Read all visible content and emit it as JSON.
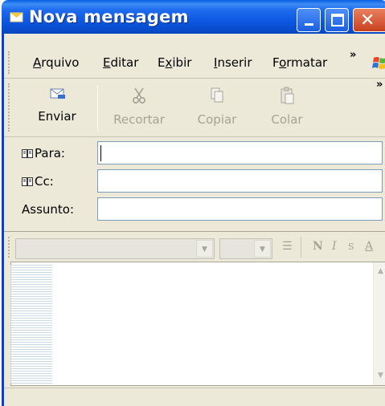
{
  "window": {
    "title": "Nova mensagem"
  },
  "menu": {
    "items": [
      {
        "label": "Arquivo",
        "accel": "A",
        "rest": "rquivo"
      },
      {
        "label": "Editar",
        "accel": "E",
        "rest": "ditar"
      },
      {
        "label": "Exibir",
        "pre": "E",
        "accel": "x",
        "rest": "ibir"
      },
      {
        "label": "Inserir",
        "accel": "I",
        "rest": "nserir"
      },
      {
        "label": "Formatar",
        "pre": "F",
        "accel": "o",
        "rest": "rmatar"
      }
    ],
    "overflow": "»"
  },
  "toolbar": {
    "send": "Enviar",
    "cut": "Recortar",
    "copy": "Copiar",
    "paste": "Colar",
    "overflow": "»"
  },
  "header": {
    "to_label": "Para:",
    "cc_label": "Cc:",
    "subject_label": "Assunto:",
    "to_value": "",
    "cc_value": "",
    "subject_value": ""
  },
  "format": {
    "bold": "N",
    "italic": "I",
    "strike": "S",
    "font_color": "A"
  },
  "colors": {
    "titlebar": "#0a54db",
    "chrome": "#ece9d8",
    "close": "#c8411e"
  },
  "icons": [
    "envelope-send-icon",
    "scissors-icon",
    "copy-icon",
    "paste-icon",
    "address-book-icon",
    "windows-flag-icon"
  ]
}
